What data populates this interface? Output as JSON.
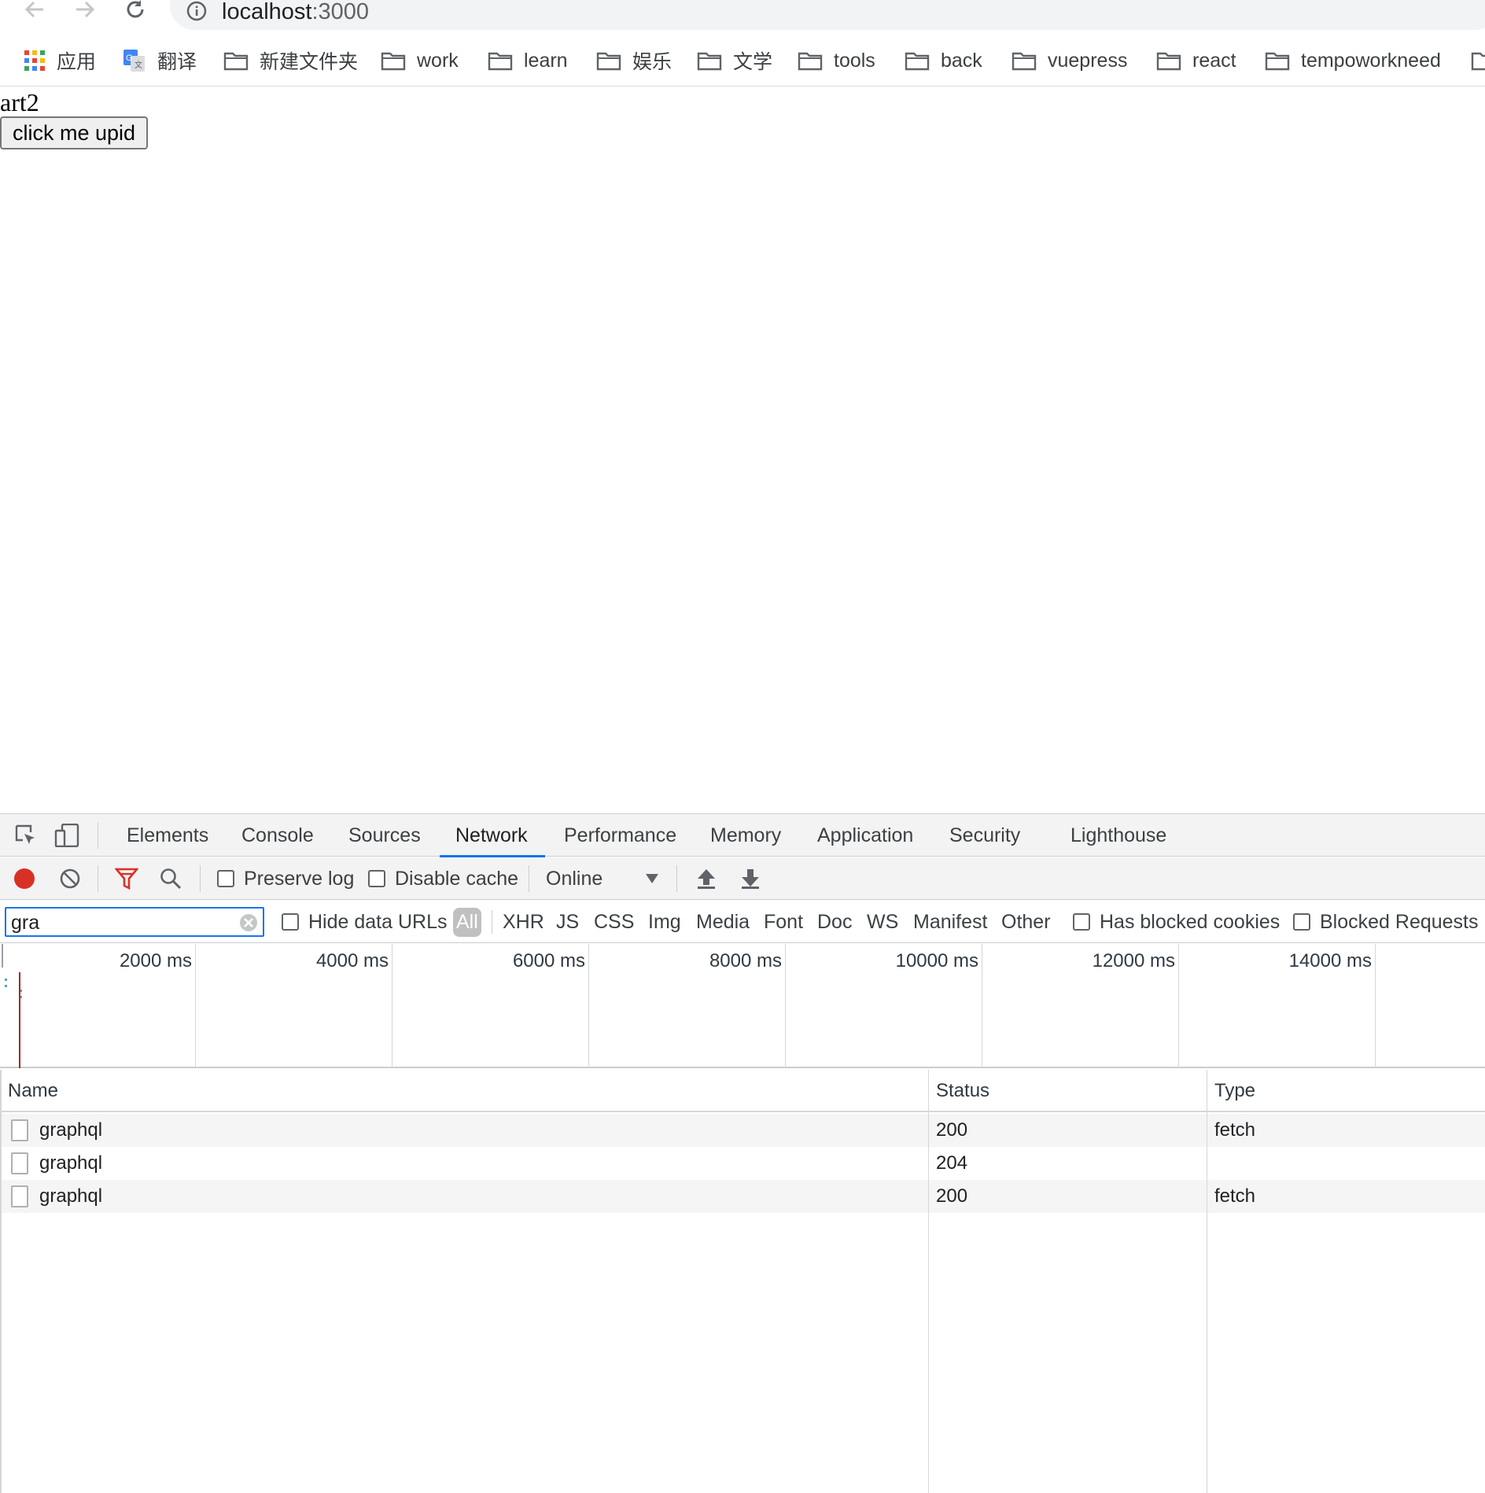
{
  "browser": {
    "url_host": "localhost",
    "url_port": ":3000",
    "bookmarks": [
      {
        "label": "应用",
        "icon": "apps-grid-icon"
      },
      {
        "label": "翻译",
        "icon": "google-translate-icon"
      },
      {
        "label": "新建文件夹",
        "icon": "folder-icon"
      },
      {
        "label": "work",
        "icon": "folder-icon"
      },
      {
        "label": "learn",
        "icon": "folder-icon"
      },
      {
        "label": "娱乐",
        "icon": "folder-icon"
      },
      {
        "label": "文学",
        "icon": "folder-icon"
      },
      {
        "label": "tools",
        "icon": "folder-icon"
      },
      {
        "label": "back",
        "icon": "folder-icon"
      },
      {
        "label": "vuepress",
        "icon": "folder-icon"
      },
      {
        "label": "react",
        "icon": "folder-icon"
      },
      {
        "label": "tempoworkneed",
        "icon": "folder-icon"
      }
    ]
  },
  "page": {
    "heading": "art2",
    "button_label": "click me upid"
  },
  "devtools": {
    "tabs": [
      "Elements",
      "Console",
      "Sources",
      "Network",
      "Performance",
      "Memory",
      "Application",
      "Security",
      "Lighthouse"
    ],
    "active_tab": "Network",
    "controls": {
      "preserve_log": "Preserve log",
      "disable_cache": "Disable cache",
      "throttling": "Online"
    },
    "filter": {
      "value": "gra",
      "hide_data_urls": "Hide data URLs",
      "types": [
        "All",
        "XHR",
        "JS",
        "CSS",
        "Img",
        "Media",
        "Font",
        "Doc",
        "WS",
        "Manifest",
        "Other"
      ],
      "active_type": "All",
      "has_blocked_cookies": "Has blocked cookies",
      "blocked_requests": "Blocked Requests"
    },
    "timeline_labels": [
      "2000 ms",
      "4000 ms",
      "6000 ms",
      "8000 ms",
      "10000 ms",
      "12000 ms",
      "14000 ms"
    ],
    "table": {
      "columns": [
        "Name",
        "Status",
        "Type"
      ],
      "rows": [
        {
          "name": "graphql",
          "status": "200",
          "type": "fetch"
        },
        {
          "name": "graphql",
          "status": "204",
          "type": ""
        },
        {
          "name": "graphql",
          "status": "200",
          "type": "fetch"
        }
      ]
    },
    "colors": {
      "accent": "#1a73e8",
      "record": "#d93025",
      "filter": "#d93025"
    }
  }
}
